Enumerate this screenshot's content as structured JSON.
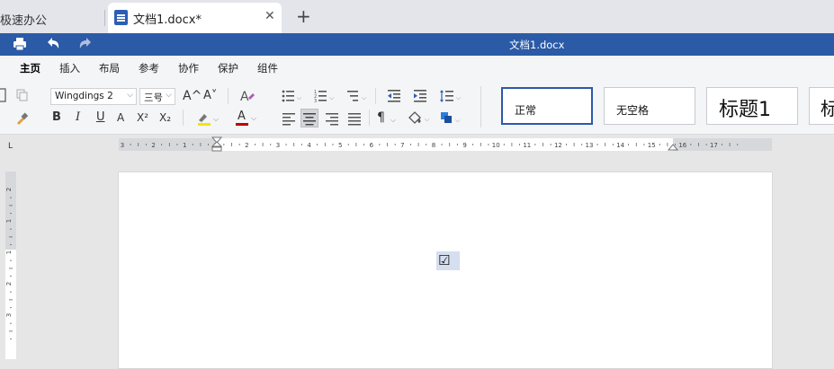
{
  "tabs": {
    "inactive_label": "极速办公",
    "active_label": "文档1.docx*",
    "close_glyph": "✕",
    "new_tab_glyph": "+"
  },
  "titlebar": {
    "title": "文档1.docx"
  },
  "ribbon": {
    "tabs": [
      "主页",
      "插入",
      "布局",
      "参考",
      "协作",
      "保护",
      "组件"
    ],
    "active_index": 0
  },
  "toolbar": {
    "font_name": "Wingdings 2",
    "font_size": "三号",
    "bold": "B",
    "italic": "I",
    "underline": "U",
    "strikethrough": "A",
    "superscript": "X²",
    "subscript": "X₂",
    "grow_font": "A^",
    "shrink_font": "A˅",
    "font_color": "A",
    "paragraph_mark": "¶"
  },
  "styles": [
    "正常",
    "无空格",
    "标题1",
    "标"
  ],
  "document": {
    "content": "☑"
  },
  "ruler": {
    "corner_glyph": "L",
    "horizontal_labels": [
      "3",
      "2",
      "1",
      "1",
      "2",
      "3",
      "4",
      "5",
      "6",
      "7",
      "8",
      "9",
      "10",
      "11",
      "12",
      "13",
      "14",
      "15",
      "16",
      "17"
    ],
    "vertical_labels": [
      "2",
      "1",
      "1",
      "2",
      "3"
    ]
  },
  "colors": {
    "title_bar": "#2b5aa7",
    "doc_icon": "#2b5fb3",
    "selection": "#d5dff0",
    "highlight_yellow": "#f5e400",
    "font_color_bar": "#c00000"
  }
}
